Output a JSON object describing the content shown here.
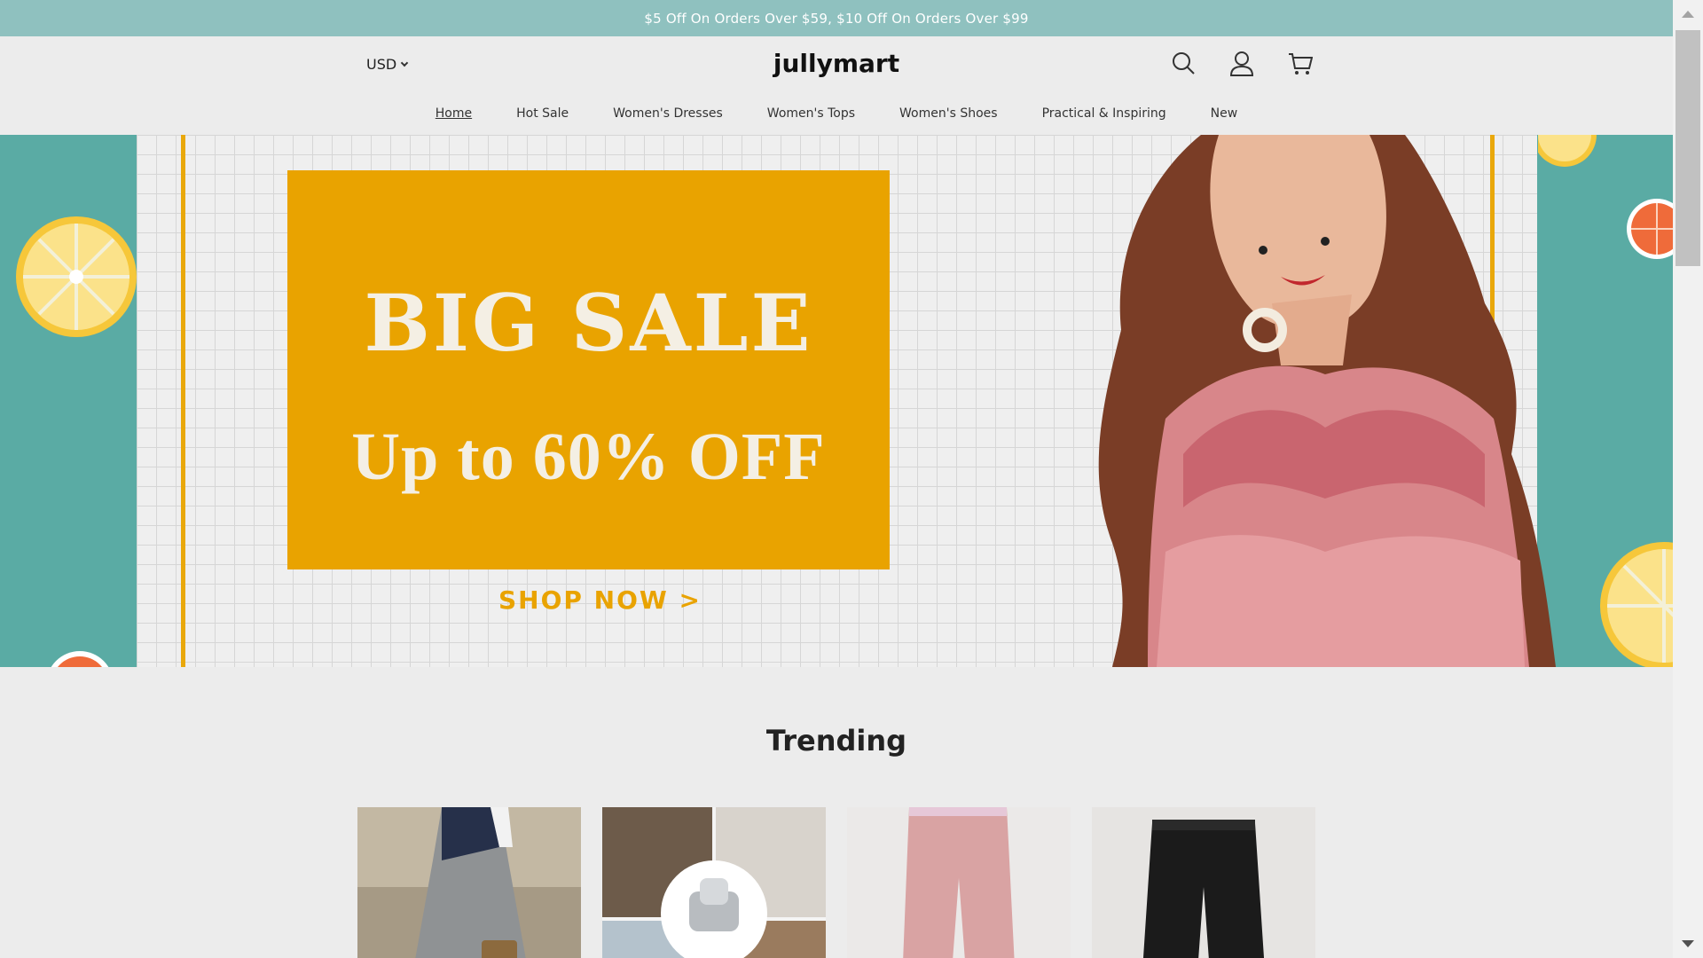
{
  "announcement": "$5 Off On Orders Over $59, $10 Off On Orders Over $99",
  "header": {
    "currency": "USD",
    "logo": "jullymart",
    "icons": [
      "search-icon",
      "account-icon",
      "cart-icon"
    ]
  },
  "nav": {
    "items": [
      {
        "label": "Home",
        "active": true
      },
      {
        "label": "Hot Sale"
      },
      {
        "label": "Women's Dresses"
      },
      {
        "label": "Women's Tops"
      },
      {
        "label": "Women's Shoes"
      },
      {
        "label": "Practical & Inspiring"
      },
      {
        "label": "New"
      }
    ]
  },
  "hero": {
    "headline": "BIG SALE",
    "subline": "Up to 60% OFF",
    "cta": "SHOP NOW >"
  },
  "trending": {
    "title": "Trending",
    "products": [
      "dress-product",
      "door-stopper-product",
      "pink-pants-product",
      "black-pants-product"
    ]
  },
  "colors": {
    "announcement_bg": "#8fc1bf",
    "hero_teal": "#5aaba4",
    "sale_yellow": "#e9a300"
  }
}
